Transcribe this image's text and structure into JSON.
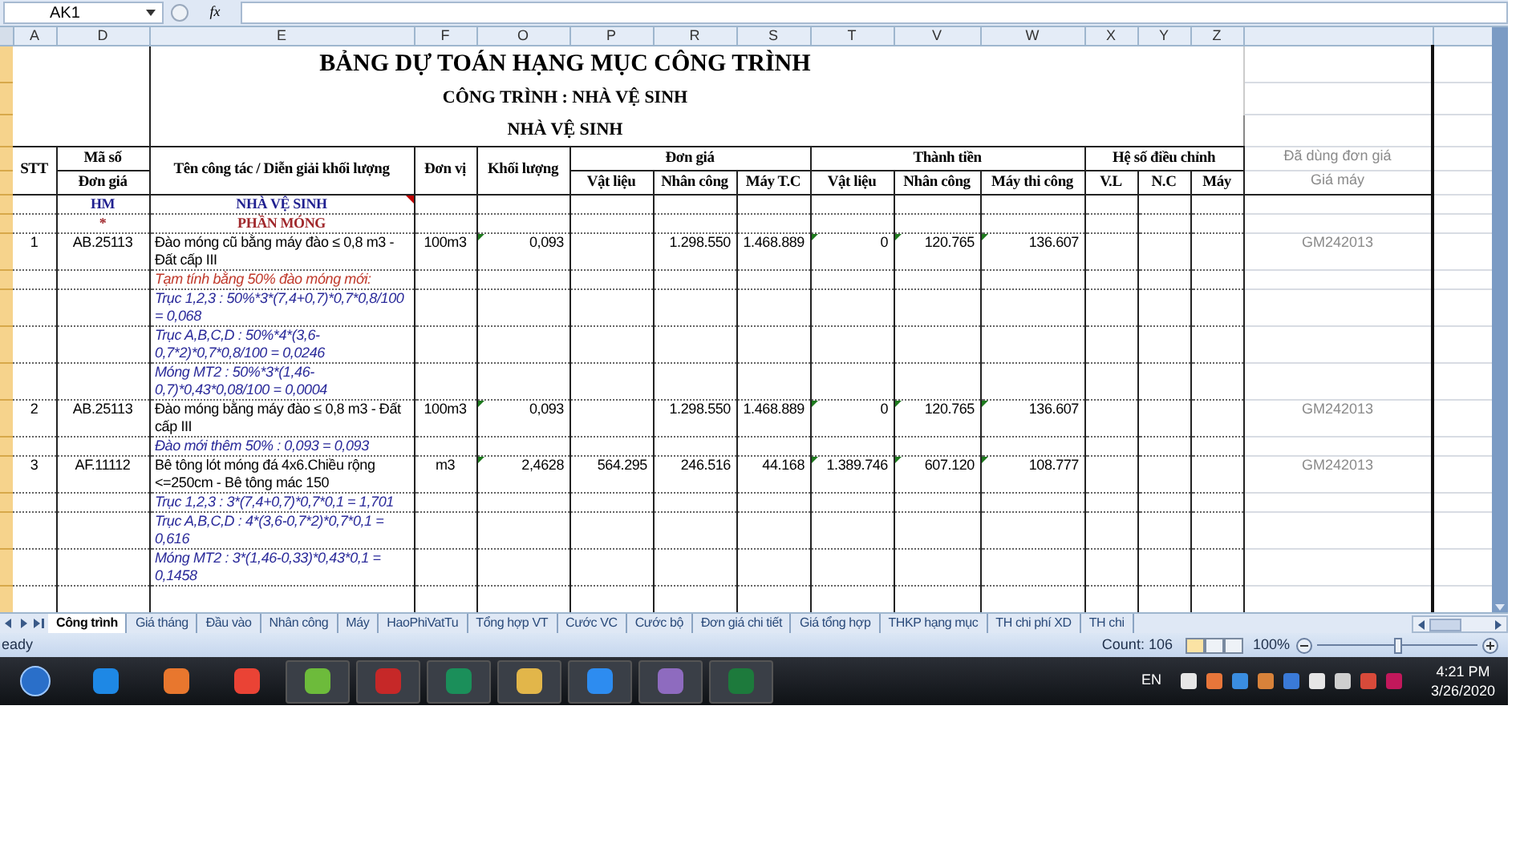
{
  "formula_bar": {
    "name_box": "AK1",
    "fx_label": "fx"
  },
  "column_headers": [
    "A",
    "D",
    "E",
    "F",
    "O",
    "P",
    "R",
    "S",
    "T",
    "V",
    "W",
    "X",
    "Y",
    "Z"
  ],
  "title_rows": [
    "BẢNG DỰ TOÁN HẠNG MỤC CÔNG TRÌNH",
    "CÔNG TRÌNH : NHÀ VỆ SINH",
    "NHÀ VỆ SINH"
  ],
  "header": {
    "stt": "STT",
    "code_top": "Mã số",
    "code_bottom": "Đơn giá",
    "name": "Tên công tác / Diễn giải khối lượng",
    "unit": "Đơn vị",
    "qty": "Khối lượng",
    "groups": [
      {
        "label": "Đơn giá",
        "sub": [
          "Vật liệu",
          "Nhân công",
          "Máy T.C"
        ]
      },
      {
        "label": "Thành tiền",
        "sub": [
          "Vật liệu",
          "Nhân công",
          "Máy thi công"
        ]
      },
      {
        "label": "Hệ số điều chỉnh",
        "sub": [
          "V.L",
          "N.C",
          "Máy"
        ]
      }
    ],
    "ref_top": "Đã dùng đơn giá",
    "ref_bottom": "Giá máy"
  },
  "rows": [
    {
      "kind": "section",
      "code": "HM",
      "text": "NHÀ VỆ SINH",
      "color": "#1f1f8f"
    },
    {
      "kind": "section",
      "code": "*",
      "text": "PHẦN MÓNG",
      "color": "#a0282c"
    },
    {
      "kind": "item",
      "stt": "1",
      "code": "AB.25113",
      "name": "Đào móng cũ bằng máy đào ≤ 0,8 m3  - Đất cấp III",
      "unit": "100m3",
      "qty": "0,093",
      "price_vl": "",
      "price_nc": "1.298.550",
      "price_m": "1.468.889",
      "total_vl": "0",
      "total_nc": "120.765",
      "total_m": "136.607",
      "ref": "GM242013"
    },
    {
      "kind": "detail",
      "text": "Tạm tính bằng 50% đào móng mới:",
      "color": "#c0392b"
    },
    {
      "kind": "detail",
      "text": "Trục 1,2,3 : 50%*3*(7,4+0,7)*0,7*0,8/100 = 0,068",
      "color": "#2a2a9a"
    },
    {
      "kind": "detail",
      "text": "Trục A,B,C,D : 50%*4*(3,6-0,7*2)*0,7*0,8/100 = 0,0246",
      "color": "#2a2a9a"
    },
    {
      "kind": "detail",
      "text": "Móng MT2 : 50%*3*(1,46-0,7)*0,43*0,08/100 = 0,0004",
      "color": "#2a2a9a"
    },
    {
      "kind": "item",
      "stt": "2",
      "code": "AB.25113",
      "name": "Đào móng bằng máy đào ≤ 0,8 m3  - Đất cấp III",
      "unit": "100m3",
      "qty": "0,093",
      "price_vl": "",
      "price_nc": "1.298.550",
      "price_m": "1.468.889",
      "total_vl": "0",
      "total_nc": "120.765",
      "total_m": "136.607",
      "ref": "GM242013"
    },
    {
      "kind": "detail",
      "text": "Đào mới thêm 50% : 0,093 = 0,093",
      "color": "#2a2a9a"
    },
    {
      "kind": "item",
      "stt": "3",
      "code": "AF.11112",
      "name": "Bê tông lót móng đá 4x6.Chiều rộng <=250cm - Bê tông mác 150",
      "unit": "m3",
      "qty": "2,4628",
      "price_vl": "564.295",
      "price_nc": "246.516",
      "price_m": "44.168",
      "total_vl": "1.389.746",
      "total_nc": "607.120",
      "total_m": "108.777",
      "ref": "GM242013"
    },
    {
      "kind": "detail",
      "text": "Trục 1,2,3 : 3*(7,4+0,7)*0,7*0,1 = 1,701",
      "color": "#2a2a9a"
    },
    {
      "kind": "detail",
      "text": "Trục A,B,C,D : 4*(3,6-0,7*2)*0,7*0,1 = 0,616",
      "color": "#2a2a9a"
    },
    {
      "kind": "detail",
      "text": "Móng MT2 : 3*(1,46-0,33)*0,43*0,1 = 0,1458",
      "color": "#2a2a9a"
    }
  ],
  "sheet_tabs": [
    {
      "label": "Công trình",
      "selected": true
    },
    {
      "label": "Giá tháng",
      "selected": false
    },
    {
      "label": "Đầu vào",
      "selected": false
    },
    {
      "label": "Nhân công",
      "selected": false
    },
    {
      "label": "Máy",
      "selected": false
    },
    {
      "label": "HaoPhiVatTu",
      "selected": false
    },
    {
      "label": "Tổng hợp VT",
      "selected": false
    },
    {
      "label": "Cước VC",
      "selected": false
    },
    {
      "label": "Cước bộ",
      "selected": false
    },
    {
      "label": "Đơn giá chi tiết",
      "selected": false
    },
    {
      "label": "Giá tổng hợp",
      "selected": false
    },
    {
      "label": "THKP hạng mục",
      "selected": false
    },
    {
      "label": "TH chi phí XD",
      "selected": false
    },
    {
      "label": "TH chi",
      "selected": false
    }
  ],
  "status_bar": {
    "mode": "eady",
    "count": "Count: 106",
    "zoom": {
      "label": "100%",
      "level": 0.5
    }
  },
  "taskbar": {
    "language": "EN",
    "time": "4:21 PM",
    "date": "3/26/2020"
  }
}
